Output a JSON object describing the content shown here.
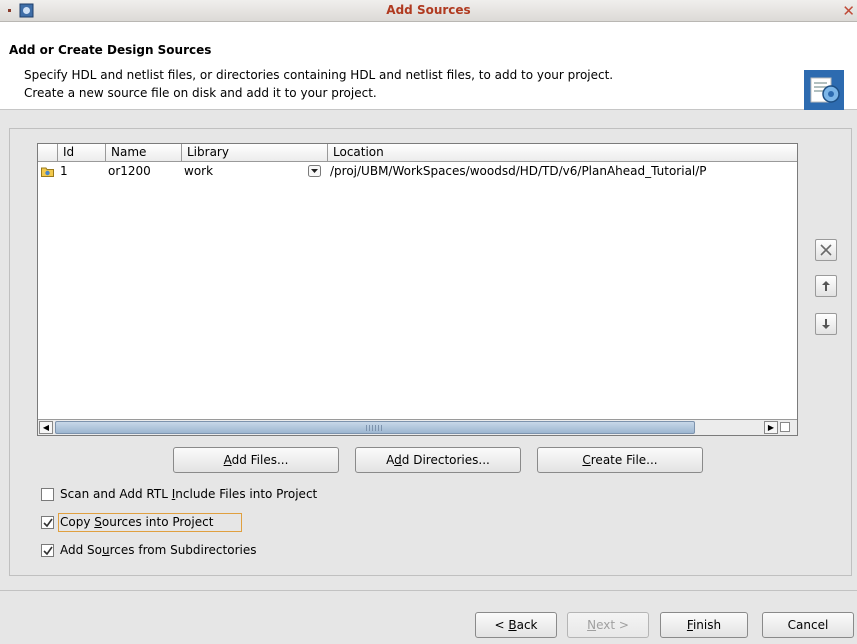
{
  "window": {
    "title": "Add Sources"
  },
  "header": {
    "title": "Add or Create Design Sources",
    "description_line1": "Specify HDL and netlist files, or directories containing HDL and netlist files, to add to your project.",
    "description_line2": "Create a new source file on disk and add it to your project."
  },
  "table": {
    "columns": [
      "Id",
      "Name",
      "Library",
      "Location"
    ],
    "rows": [
      {
        "id": "1",
        "name": "or1200",
        "library": "work",
        "location": "/proj/UBM/WorkSpaces/woodsd/HD/TD/v6/PlanAhead_Tutorial/P"
      }
    ]
  },
  "buttons": {
    "add_files": {
      "pre": "",
      "mnemonic": "A",
      "post": "dd Files..."
    },
    "add_directories": {
      "pre": "A",
      "mnemonic": "d",
      "post": "d Directories..."
    },
    "create_file": {
      "pre": "",
      "mnemonic": "C",
      "post": "reate File..."
    }
  },
  "options": {
    "scan_rtl": {
      "pre": "Scan and Add RTL ",
      "mnemonic": "I",
      "post": "nclude Files into Project",
      "checked": false
    },
    "copy_sources": {
      "pre": "Copy ",
      "mnemonic": "S",
      "post": "ources into Project",
      "checked": true
    },
    "add_subdirs": {
      "pre": "Add So",
      "mnemonic": "u",
      "post": "rces from Subdirectories",
      "checked": true
    }
  },
  "footer": {
    "back": {
      "pre": "< ",
      "mnemonic": "B",
      "post": "ack"
    },
    "next": {
      "pre": "",
      "mnemonic": "N",
      "post": "ext >"
    },
    "finish": {
      "pre": "",
      "mnemonic": "F",
      "post": "inish"
    },
    "cancel": "Cancel"
  },
  "icons": {
    "app": "planahead-app-icon",
    "wizard": "wizard-page-icon",
    "remove": "remove-x-icon",
    "move_up": "move-up-arrow-icon",
    "move_down": "move-down-arrow-icon",
    "row": "source-file-icon",
    "library_dropdown": "dropdown-arrow-icon"
  },
  "colors": {
    "title_text": "#b03a20",
    "scroll_thumb": "#9db6d1",
    "focus_ring": "#e0a040"
  }
}
